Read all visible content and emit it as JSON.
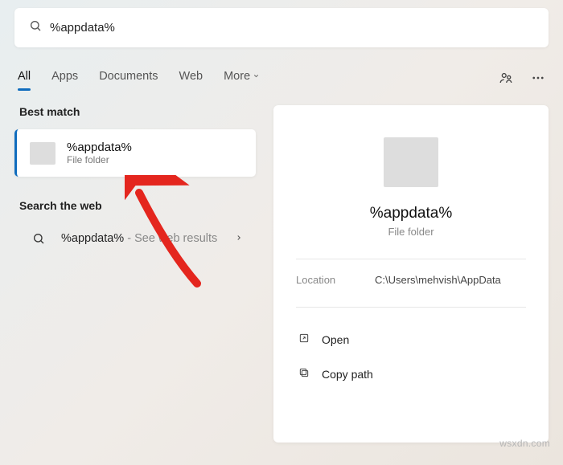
{
  "search": {
    "query": "%appdata%"
  },
  "tabs": {
    "items": [
      {
        "label": "All",
        "active": true
      },
      {
        "label": "Apps",
        "active": false
      },
      {
        "label": "Documents",
        "active": false
      },
      {
        "label": "Web",
        "active": false
      },
      {
        "label": "More",
        "active": false
      }
    ]
  },
  "left": {
    "best_match_header": "Best match",
    "best_match": {
      "title": "%appdata%",
      "subtitle": "File folder"
    },
    "search_web_header": "Search the web",
    "web_item": {
      "title": "%appdata%",
      "suffix": " - See web results"
    }
  },
  "details": {
    "title": "%appdata%",
    "subtitle": "File folder",
    "location_label": "Location",
    "location_value": "C:\\Users\\mehvish\\AppData",
    "actions": [
      {
        "icon": "open-icon",
        "label": "Open"
      },
      {
        "icon": "copy-icon",
        "label": "Copy path"
      }
    ]
  },
  "watermark": "wsxdn.com"
}
